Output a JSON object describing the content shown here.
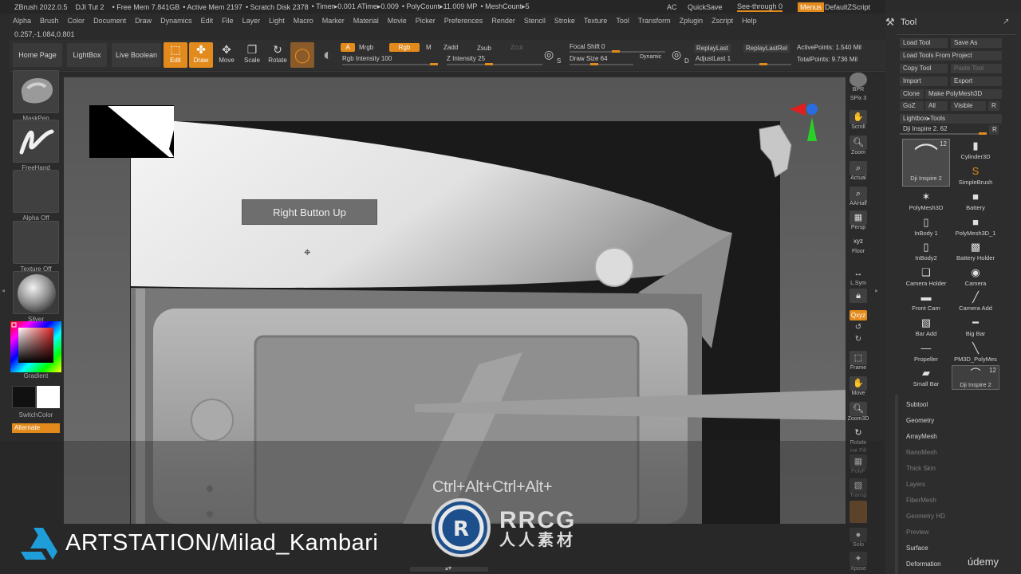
{
  "titlebar": {
    "app": "ZBrush 2022.0.5",
    "doc": "DJI Tut 2",
    "free_mem": "• Free Mem 7.841GB",
    "active_mem": "• Active Mem 2197",
    "scratch": "• Scratch Disk 2378",
    "timer": "• Timer▸0.001 ATime▸0.009",
    "polycount": "• PolyCount▸11.009 MP",
    "meshcount": "• MeshCount▸5",
    "ac": "AC",
    "quicksave": "QuickSave",
    "see_through": "See-through  0",
    "menus": "Menus",
    "script": "DefaultZScript"
  },
  "menubar": [
    "Alpha",
    "Brush",
    "Color",
    "Document",
    "Draw",
    "Dynamics",
    "Edit",
    "File",
    "Layer",
    "Light",
    "Macro",
    "Marker",
    "Material",
    "Movie",
    "Picker",
    "Preferences",
    "Render",
    "Stencil",
    "Stroke",
    "Texture",
    "Tool",
    "Transform",
    "Zplugin",
    "Zscript",
    "Help"
  ],
  "coords": "0.257,-1.084,0.801",
  "shelf": {
    "home": "Home Page",
    "lightbox": "LightBox",
    "live_boolean": "Live Boolean",
    "edit": "Edit",
    "draw": "Draw",
    "move": "Move",
    "scale": "Scale",
    "rotate": "Rotate",
    "a": "A",
    "mrgb": "Mrgb",
    "rgb": "Rgb",
    "m": "M",
    "zadd": "Zadd",
    "zsub": "Zsub",
    "zcut": "Zcut",
    "rgb_intensity": "Rgb Intensity 100",
    "z_intensity": "Z Intensity 25",
    "s": "S",
    "focal_shift": "Focal Shift  0",
    "draw_size": "Draw Size  64",
    "dynamic": "Dynamic",
    "d": "D",
    "replay_last": "ReplayLast",
    "replay_last_rel": "ReplayLastRel",
    "adjust_last": "AdjustLast  1",
    "active_points": "ActivePoints: 1.540 Mil",
    "total_points": "TotalPoints: 9.736 Mil"
  },
  "left": {
    "maskpen": "MaskPen",
    "freehand": "FreeHand",
    "alpha_off": "Alpha Off",
    "texture_off": "Texture Off",
    "silver": "Silver",
    "gradient": "Gradient",
    "switchcolor": "SwitchColor",
    "alternate": "Alternate"
  },
  "viewport": {
    "tooltip": "Right Button Up"
  },
  "right_toolbar": {
    "bpr": "BPR",
    "spix": "SPix 3",
    "scroll": "Scroll",
    "zoom": "Zoom",
    "actual": "Actual",
    "aahalf": "AAHalf",
    "persp": "Persp",
    "floor": "Floor",
    "lsym": "L.Sym",
    "xyz": "Qxyz",
    "frame": "Frame",
    "move": "Move",
    "zoom3d": "Zoom3D",
    "rotate": "Rotate",
    "linefill": "ine Fill",
    "polyf": "PolyF",
    "transp": "Transp",
    "solo": "Solo",
    "xpose": "Xpose"
  },
  "toolpanel": {
    "title": "Tool",
    "load_tool": "Load Tool",
    "save_as": "Save As",
    "load_from_project": "Load Tools From Project",
    "copy_tool": "Copy Tool",
    "paste_tool": "Paste Tool",
    "import": "Import",
    "export": "Export",
    "clone": "Clone",
    "make_polymesh": "Make PolyMesh3D",
    "goz": "GoZ",
    "all": "All",
    "visible": "Visible",
    "r": "R",
    "lightbox_tools": "Lightbox▸Tools",
    "current_tool": "Dji Inspire 2.  62",
    "r2": "R",
    "subtools": [
      {
        "label": "Dji Inspire 2",
        "badge": "12",
        "icon": "drone-icon"
      },
      {
        "label": "Cylinder3D",
        "icon": "cylinder-icon"
      },
      {
        "label": "SimpleBrush",
        "icon": "simplebrush-icon"
      },
      {
        "label": "PolyMesh3D",
        "icon": "star-icon"
      },
      {
        "label": "Battery",
        "icon": "battery-icon"
      },
      {
        "label": "InBody 1",
        "icon": "inbody-icon"
      },
      {
        "label": "PolyMesh3D_1",
        "icon": "polymesh-icon"
      },
      {
        "label": "InBody2",
        "icon": "inbody-icon"
      },
      {
        "label": "Battery Holder",
        "icon": "holder-icon"
      },
      {
        "label": "Camera Holder",
        "icon": "camera-holder-icon"
      },
      {
        "label": "Camera",
        "icon": "camera-icon"
      },
      {
        "label": "Front Cam",
        "icon": "frontcam-icon"
      },
      {
        "label": "Camera Add",
        "icon": "camera-add-icon"
      },
      {
        "label": "Bar Add",
        "icon": "bar-add-icon"
      },
      {
        "label": "Big Bar",
        "icon": "big-bar-icon"
      },
      {
        "label": "Propeller",
        "icon": "propeller-icon"
      },
      {
        "label": "PM3D_PolyMes",
        "icon": "pm3d-icon"
      },
      {
        "label": "Small Bar",
        "icon": "small-bar-icon"
      },
      {
        "label": "Dji Inspire 2",
        "badge": "12",
        "icon": "drone-icon"
      }
    ],
    "menus": [
      {
        "label": "Subtool",
        "dim": false
      },
      {
        "label": "Geometry",
        "dim": false
      },
      {
        "label": "ArrayMesh",
        "dim": false
      },
      {
        "label": "NanoMesh",
        "dim": true
      },
      {
        "label": "Thick Skin",
        "dim": true
      },
      {
        "label": "Layers",
        "dim": true
      },
      {
        "label": "FiberMesh",
        "dim": true
      },
      {
        "label": "Geometry HD",
        "dim": true
      },
      {
        "label": "Preview",
        "dim": true
      },
      {
        "label": "Surface",
        "dim": false
      },
      {
        "label": "Deformation",
        "dim": false
      }
    ]
  },
  "overlay": {
    "keys": "Ctrl+Alt+Ctrl+Alt+",
    "artstation": "ARTSTATION/Milad_Kambari",
    "watermark_rrcg": "RRCG",
    "watermark_cn": "人人素材",
    "udemy": "údemy"
  },
  "colors": {
    "accent": "#e28a1c",
    "panel": "#2d2d2d",
    "viewport": "#6b6b6b"
  }
}
